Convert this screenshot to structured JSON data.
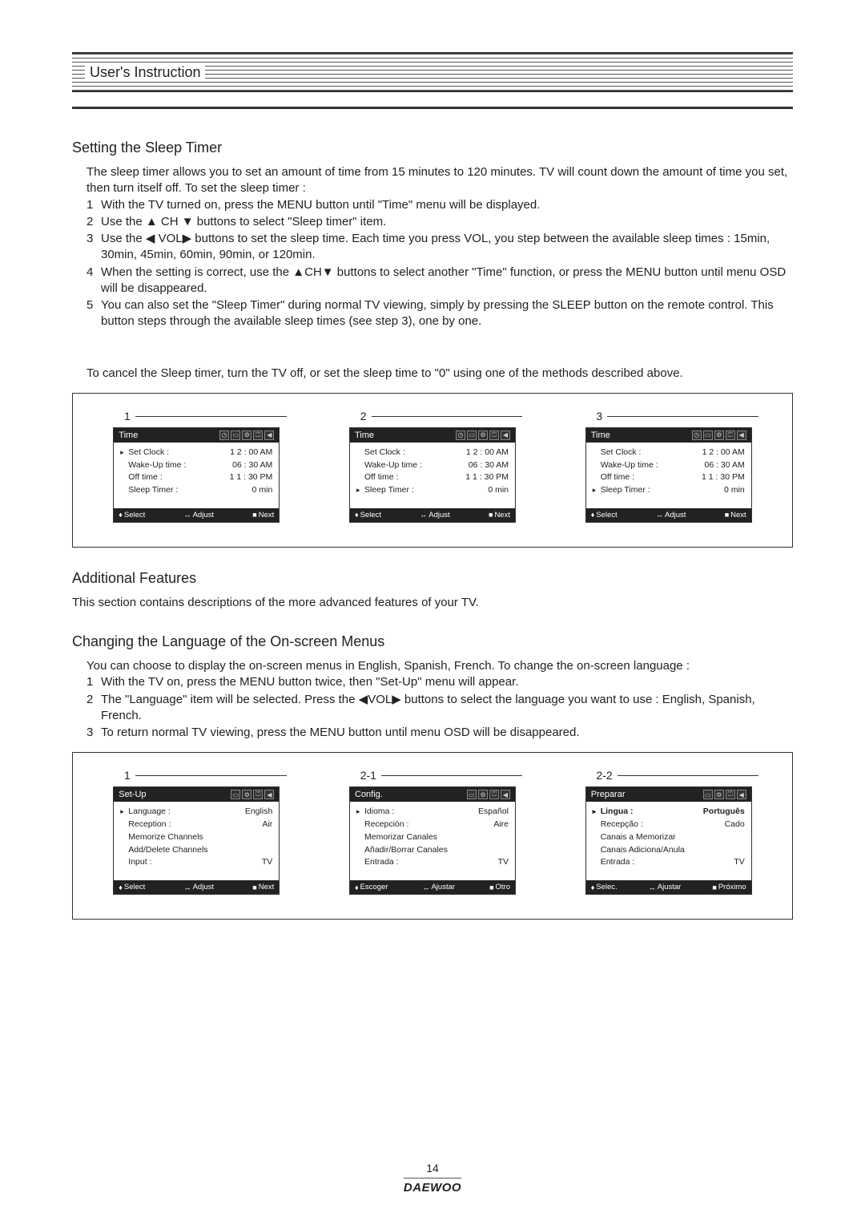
{
  "header": {
    "title": "User's Instruction"
  },
  "sleep": {
    "title": "Setting the Sleep Timer",
    "intro": "The sleep timer allows you to set an amount of time from 15 minutes to 120 minutes. TV will count down the amount of time you set, then turn itself off. To set the sleep timer :",
    "steps": [
      "With the TV turned on, press the MENU button until \"Time\" menu will be displayed.",
      "Use the ▲ CH ▼ buttons to select \"Sleep timer\" item.",
      "Use the ◀ VOL▶ buttons to set the sleep time. Each time you press VOL, you step between the available sleep times : 15min, 30min, 45min, 60min, 90min, or 120min.",
      "When the setting is correct, use the ▲CH▼ buttons to select another \"Time\" function, or press the MENU button until menu OSD will be disappeared.",
      "You can also set the \"Sleep Timer\" during normal TV viewing, simply by pressing the SLEEP button on the remote control. This button steps through the available sleep times (see step 3), one by one."
    ],
    "cancel": "To cancel the Sleep timer, turn the TV off, or set the sleep time to \"0\" using one of the methods described above."
  },
  "additional": {
    "title": "Additional Features",
    "intro": "This section contains descriptions of the more advanced features of your TV."
  },
  "lang": {
    "title": "Changing the Language of the On-screen Menus",
    "intro": "You can choose to display the on-screen menus in English, Spanish, French. To change the on-screen language :",
    "steps": [
      "With the TV on, press the MENU button twice, then \"Set-Up\" menu will appear.",
      "The \"Language\" item will be selected. Press the ◀VOL▶ buttons to select the language you want to use : English, Spanish, French.",
      "To return normal TV viewing, press the MENU button until menu OSD will be disappeared."
    ]
  },
  "osd_time": {
    "panels": [
      "1",
      "2",
      "3"
    ],
    "title": "Time",
    "rows": [
      {
        "label": "Set Clock :",
        "value": "1 2 : 00 AM"
      },
      {
        "label": "Wake-Up time :",
        "value": "06 : 30 AM"
      },
      {
        "label": "Off time :",
        "value": "1 1 : 30 PM"
      },
      {
        "label": "Sleep Timer :",
        "value": "0 min"
      }
    ],
    "selected": [
      0,
      3,
      3
    ],
    "foot": {
      "select": "Select",
      "adjust": "Adjust",
      "next": "Next"
    }
  },
  "osd_setup": {
    "panels": [
      "1",
      "2-1",
      "2-2"
    ],
    "screens": [
      {
        "title": "Set-Up",
        "rows": [
          {
            "label": "Language :",
            "value": "English",
            "ptr": true
          },
          {
            "label": "Reception :",
            "value": "Air"
          },
          {
            "label": "Memorize Channels",
            "value": ""
          },
          {
            "label": "Add/Delete Channels",
            "value": ""
          },
          {
            "label": "Input :",
            "value": "TV"
          }
        ],
        "foot": {
          "select": "Select",
          "adjust": "Adjust",
          "next": "Next"
        }
      },
      {
        "title": "Config.",
        "rows": [
          {
            "label": "Idioma :",
            "value": "Español",
            "ptr": true
          },
          {
            "label": "Recepción :",
            "value": "Aire"
          },
          {
            "label": "Memorizar Canales",
            "value": ""
          },
          {
            "label": "Añadir/Borrar Canales",
            "value": ""
          },
          {
            "label": "Entrada :",
            "value": "TV"
          }
        ],
        "foot": {
          "select": "Escoger",
          "adjust": "Ajustar",
          "next": "Otro"
        }
      },
      {
        "title": "Preparar",
        "rows": [
          {
            "label": "Lingua :",
            "value": "Português",
            "ptr": true,
            "bold": true
          },
          {
            "label": "Recepção :",
            "value": "Cado"
          },
          {
            "label": "Canais a Memorizar",
            "value": ""
          },
          {
            "label": "Canais Adiciona/Anula",
            "value": ""
          },
          {
            "label": "Entrada :",
            "value": "TV"
          }
        ],
        "foot": {
          "select": "Selec.",
          "adjust": "Ajustar",
          "next": "Próximo"
        }
      }
    ]
  },
  "icons": {
    "clock": "◷",
    "tabset": [
      "▭",
      "⚙",
      "⏍",
      "◀"
    ]
  },
  "page": {
    "num": "14",
    "brand": "DAEWOO"
  }
}
